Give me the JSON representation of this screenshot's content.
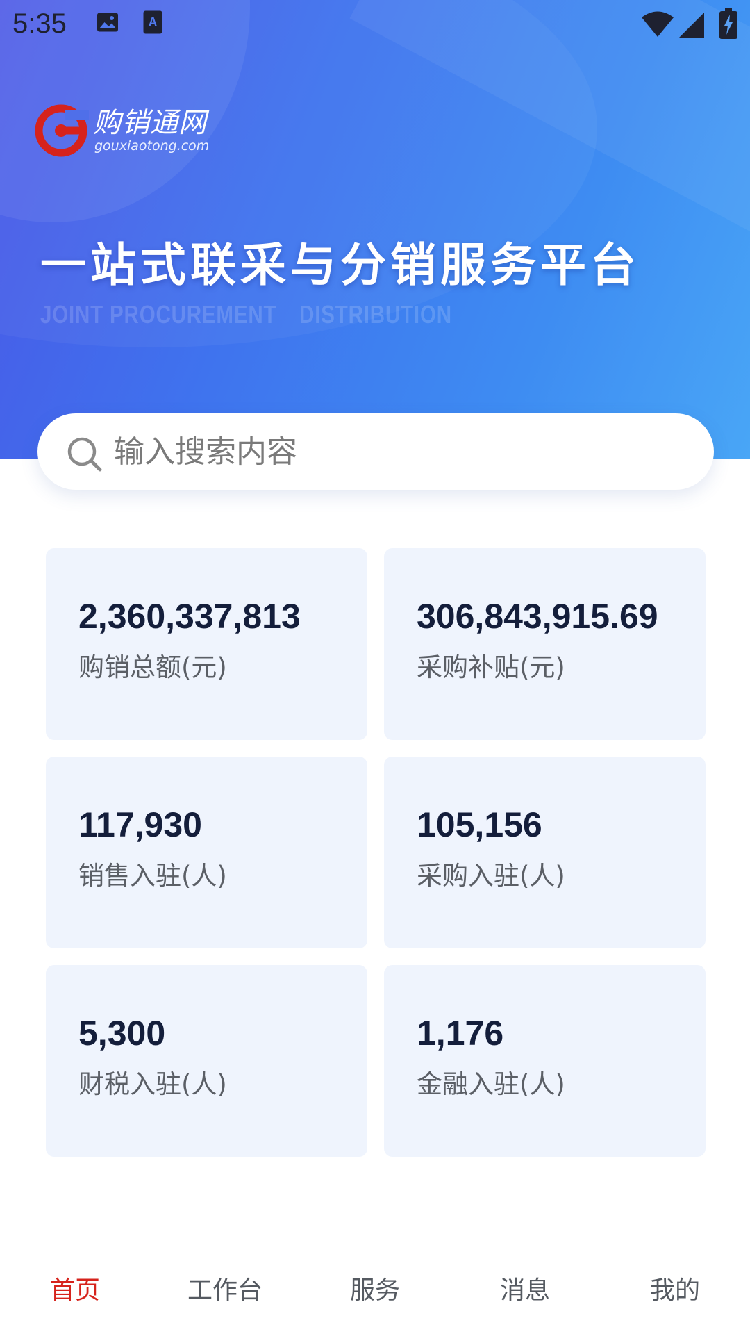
{
  "status_bar": {
    "time": "5:35",
    "icons": [
      "image-icon",
      "text-a-icon",
      "wifi-icon",
      "cell-signal-icon",
      "battery-charging-icon"
    ]
  },
  "hero": {
    "logo_cn": "购销通网",
    "logo_en": "gouxiaotong.com",
    "title": "一站式联采与分销服务平台",
    "subtitle_1": "JOINT PROCUREMENT",
    "subtitle_2": "DISTRIBUTION"
  },
  "search": {
    "placeholder": "输入搜索内容",
    "value": ""
  },
  "stats": [
    {
      "value": "2,360,337,813",
      "label": "购销总额(元)"
    },
    {
      "value": "306,843,915.69",
      "label": "采购补贴(元)"
    },
    {
      "value": "117,930",
      "label": "销售入驻(人)"
    },
    {
      "value": "105,156",
      "label": "采购入驻(人)"
    },
    {
      "value": "5,300",
      "label": "财税入驻(人)"
    },
    {
      "value": "1,176",
      "label": "金融入驻(人)"
    }
  ],
  "bottom_nav": {
    "active_index": 0,
    "items": [
      {
        "label": "首页"
      },
      {
        "label": "工作台"
      },
      {
        "label": "服务"
      },
      {
        "label": "消息"
      },
      {
        "label": "我的"
      }
    ]
  },
  "colors": {
    "brand_red": "#d6231c",
    "hero_blue_start": "#4a56e6",
    "hero_blue_end": "#49a6f6",
    "card_bg": "#eff4fd",
    "value_text": "#141e3b"
  }
}
